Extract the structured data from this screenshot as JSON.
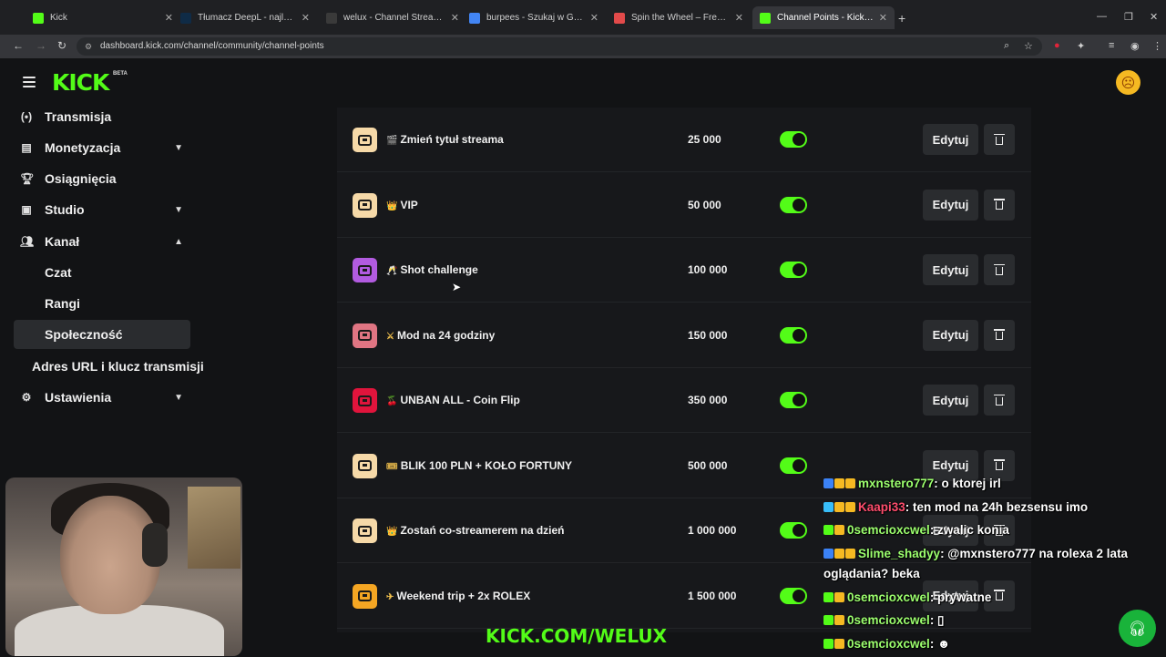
{
  "browser": {
    "tabs": [
      {
        "title": "Kick",
        "fav_color": "#53fc18"
      },
      {
        "title": "Tłumacz DeepL - najlepszy tłum",
        "fav_color": "#0f2b46"
      },
      {
        "title": "welux - Channel Streams on Kic",
        "fav_color": "#3a3a3a"
      },
      {
        "title": "burpees - Szukaj w Google",
        "fav_color": "#4285f4"
      },
      {
        "title": "Spin the Wheel – Free and easy",
        "fav_color": "#e24a4a"
      },
      {
        "title": "Channel Points - Kick Dashboar",
        "fav_color": "#53fc18"
      }
    ],
    "url": "dashboard.kick.com/channel/community/channel-points"
  },
  "header": {
    "logo": "KICK",
    "beta": "BETA"
  },
  "sidebar": {
    "items": [
      {
        "label": "Transmisja",
        "icon": "broadcast-icon"
      },
      {
        "label": "Monetyzacja",
        "icon": "chart-icon"
      },
      {
        "label": "Osiągnięcia",
        "icon": "trophy-icon"
      },
      {
        "label": "Studio",
        "icon": "studio-icon"
      },
      {
        "label": "Kanał",
        "icon": "users-icon"
      }
    ],
    "subitems": [
      "Czat",
      "Rangi",
      "Społeczność"
    ],
    "extra": "Adres URL i klucz transmisji",
    "settings": "Ustawienia"
  },
  "rewards": [
    {
      "emoji": "🎬",
      "name": "Zmień tytuł streama",
      "cost": "25 000",
      "color": "#f6d9a8",
      "edit": "Edytuj"
    },
    {
      "emoji": "👑",
      "name": "VIP",
      "cost": "50 000",
      "color": "#f6d9a8",
      "edit": "Edytuj"
    },
    {
      "emoji": "🥂",
      "name": "Shot challenge",
      "cost": "100 000",
      "color": "#b25be0",
      "edit": "Edytuj"
    },
    {
      "emoji": "⚔",
      "name": "Mod na 24 godziny",
      "cost": "150 000",
      "color": "#e07583",
      "edit": "Edytuj"
    },
    {
      "emoji": "🍒",
      "name": "UNBAN ALL - Coin Flip",
      "cost": "350 000",
      "color": "#e0143c",
      "edit": "Edytuj"
    },
    {
      "emoji": "🎟",
      "name": "BLIK 100 PLN + KOŁO FORTUNY",
      "cost": "500 000",
      "color": "#f6d9a8",
      "edit": "Edytuj"
    },
    {
      "emoji": "👑",
      "name": "Zostań co-streamerem na dzień",
      "cost": "1 000 000",
      "color": "#f6d9a8",
      "edit": "Edytuj"
    },
    {
      "emoji": "✈",
      "name": "Weekend trip + 2x ROLEX",
      "cost": "1 500 000",
      "color": "#f5a623",
      "edit": "Edytuj"
    }
  ],
  "overlay": {
    "kick_url": "KICK.COM/WELUX",
    "chat": [
      {
        "user": "mxnstero777",
        "user_color": "#9cff6e",
        "text": ": o ktorej irl",
        "badges": [
          "#3b82f6",
          "#f5b922",
          "#f5b922"
        ]
      },
      {
        "user": "Kaapi33",
        "user_color": "#ff4d6d",
        "text": ": ten mod na 24h bezsensu imo",
        "badges": [
          "#38bdf8",
          "#f5b922",
          "#f5b922"
        ]
      },
      {
        "user": "0semcioxcwel",
        "user_color": "#9cff6e",
        "text": ": zwalic konia",
        "badges": [
          "#53fc18",
          "#f5b922"
        ]
      },
      {
        "user": "Slime_shadyy",
        "user_color": "#9cff6e",
        "text": ": @mxnstero777 na rolexa 2 lata oglądania? beka",
        "badges": [
          "#3b82f6",
          "#f5b922",
          "#f5b922"
        ]
      },
      {
        "user": "0semcioxcwel",
        "user_color": "#9cff6e",
        "text": ": prywatne",
        "badges": [
          "#53fc18",
          "#f5b922"
        ]
      },
      {
        "user": "0semcioxcwel",
        "user_color": "#9cff6e",
        "text": ": ▯",
        "badges": [
          "#53fc18",
          "#f5b922"
        ]
      },
      {
        "user": "0semcioxcwel",
        "user_color": "#9cff6e",
        "text": ": ☻",
        "badges": [
          "#53fc18",
          "#f5b922"
        ]
      }
    ]
  },
  "colors": {
    "accent": "#53fc18",
    "panel": "#17181b",
    "button": "#2a2c2f"
  }
}
